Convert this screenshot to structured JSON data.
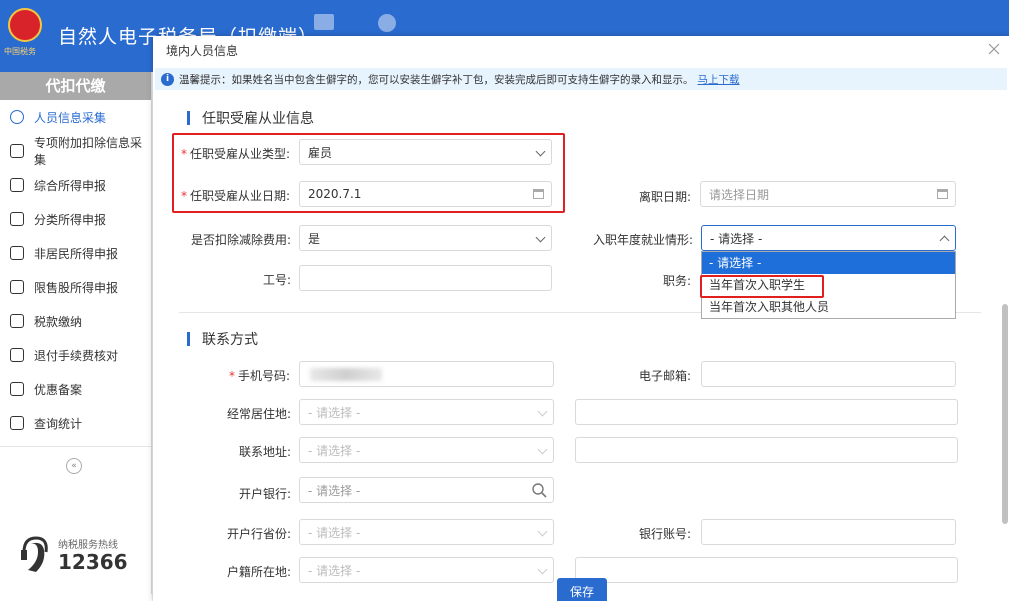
{
  "app": {
    "title": "自然人电子税务局（扣缴端）",
    "emblem_sub": "中国税务"
  },
  "sidebar": {
    "header": "代扣代缴",
    "items": [
      {
        "label": "人员信息采集",
        "icon": "person-icon",
        "active": true
      },
      {
        "label": "专项附加扣除信息采集",
        "icon": "list-icon",
        "active": false
      },
      {
        "label": "综合所得申报",
        "icon": "layers-icon",
        "active": false
      },
      {
        "label": "分类所得申报",
        "icon": "pie-icon",
        "active": false
      },
      {
        "label": "非居民所得申报",
        "icon": "person-icon",
        "active": false
      },
      {
        "label": "限售股所得申报",
        "icon": "bar-chart-icon",
        "active": false
      },
      {
        "label": "税款缴纳",
        "icon": "wallet-icon",
        "active": false
      },
      {
        "label": "退付手续费核对",
        "icon": "document-icon",
        "active": false
      },
      {
        "label": "优惠备案",
        "icon": "file-icon",
        "active": false
      },
      {
        "label": "查询统计",
        "icon": "search-list-icon",
        "active": false
      }
    ],
    "collapse": "«",
    "hotline_label": "纳税服务热线",
    "hotline_number": "12366"
  },
  "modal": {
    "title": "境内人员信息",
    "notice_text": "温馨提示：如果姓名当中包含生僻字的，您可以安装生僻字补丁包，安装完成后即可支持生僻字的录入和显示。",
    "notice_link": "马上下载",
    "employment": {
      "section_title": "任职受雇从业信息",
      "type_label": "任职受雇从业类型:",
      "type_value": "雇员",
      "date_label": "任职受雇从业日期:",
      "date_value": "2020.7.1",
      "leave_label": "离职日期:",
      "leave_placeholder": "请选择日期",
      "deduct_label": "是否扣除减除费用:",
      "deduct_value": "是",
      "situation_label": "入职年度就业情形:",
      "situation_value": "- 请选择 -",
      "situation_options": [
        "- 请选择 -",
        "当年首次入职学生",
        "当年首次入职其他人员"
      ],
      "jobno_label": "工号:",
      "position_label": "职务:"
    },
    "contact": {
      "section_title": "联系方式",
      "phone_label": "手机号码:",
      "email_label": "电子邮箱:",
      "residence_label": "经常居住地:",
      "residence_placeholder": "- 请选择 -",
      "address_label": "联系地址:",
      "address_placeholder": "- 请选择 -",
      "bank_label": "开户银行:",
      "bank_placeholder": "- 请选择 -",
      "bank_province_label": "开户行省份:",
      "bank_province_placeholder": "- 请选择 -",
      "account_label": "银行账号:",
      "household_label": "户籍所在地:",
      "household_placeholder": "- 请选择 -"
    },
    "save_label": "保存"
  }
}
